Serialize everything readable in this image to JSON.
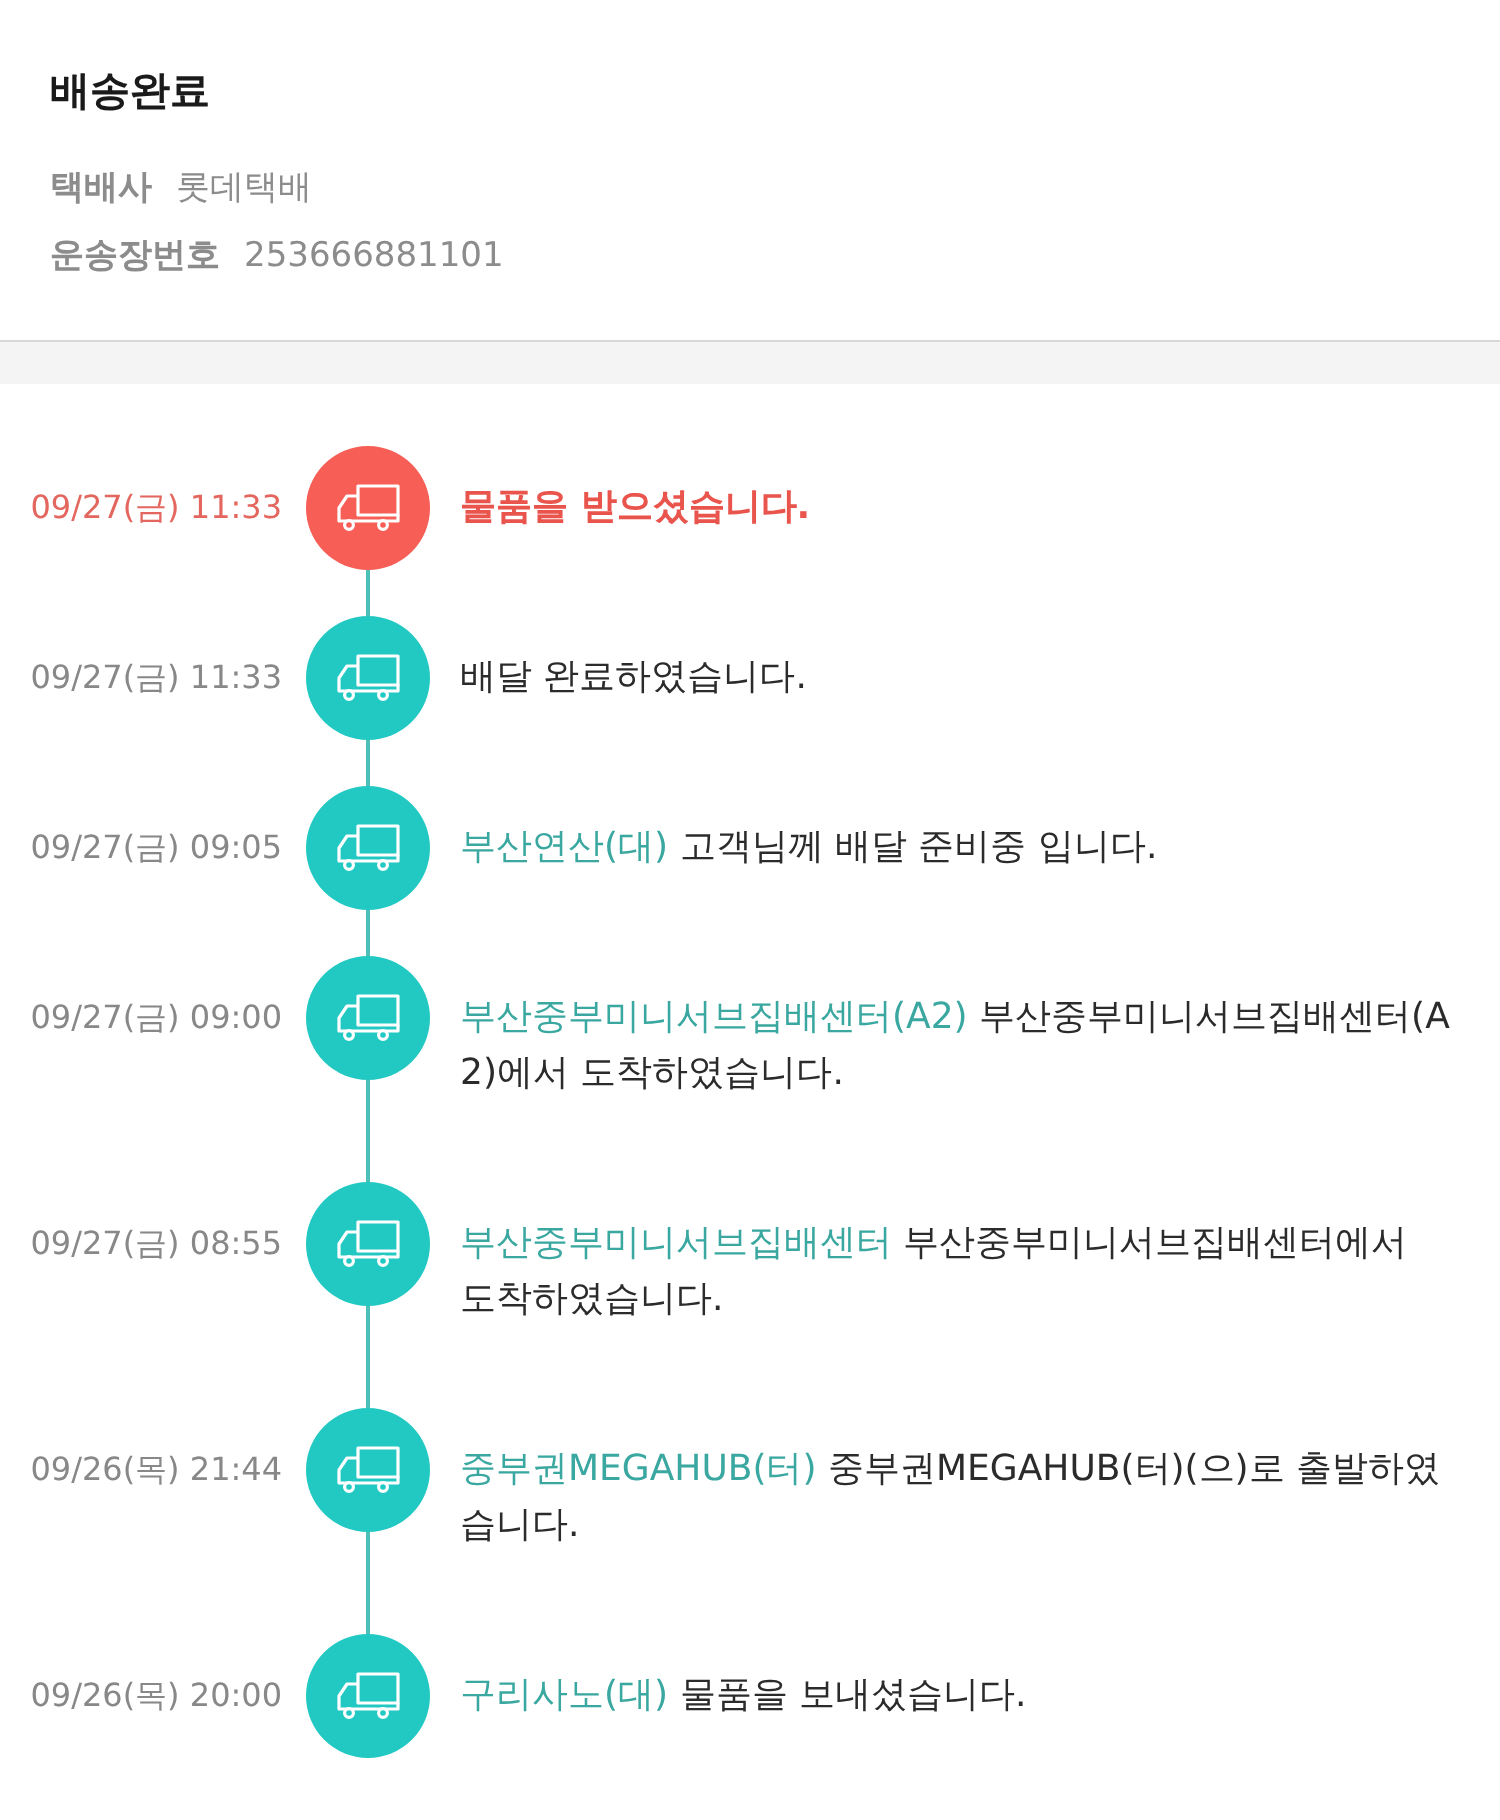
{
  "header": {
    "title": "배송완료",
    "info": [
      {
        "label": "택배사",
        "value": "롯데택배"
      },
      {
        "label": "운송장번호",
        "value": "253666881101"
      }
    ]
  },
  "events": [
    {
      "date": "09/27(금) 11:33",
      "message": "물품을 받으셨습니다.",
      "highlighted": true
    },
    {
      "date": "09/27(금) 11:33",
      "message": "배달 완료하였습니다.",
      "highlighted": false
    },
    {
      "date": "09/27(금) 09:05",
      "place": "부산연산(대)",
      "message": "고객님께 배달 준비중 입니다.",
      "highlighted": false
    },
    {
      "date": "09/27(금) 09:00",
      "place": "부산중부미니서브집배센터(A2)",
      "message": "부산중부미니서브집배센터(A2)에서 도착하였습니다.",
      "highlighted": false
    },
    {
      "date": "09/27(금) 08:55",
      "place": "부산중부미니서브집배센터",
      "message": "부산중부미니서브집배센터에서 도착하였습니다.",
      "highlighted": false
    },
    {
      "date": "09/26(목) 21:44",
      "place": "중부권MEGAHUB(터)",
      "message": "중부권MEGAHUB(터)(으)로 출발하였습니다.",
      "highlighted": false
    },
    {
      "date": "09/26(목) 20:00",
      "place": "구리사노(대)",
      "message": "물품을 보내셨습니다.",
      "highlighted": false
    }
  ]
}
